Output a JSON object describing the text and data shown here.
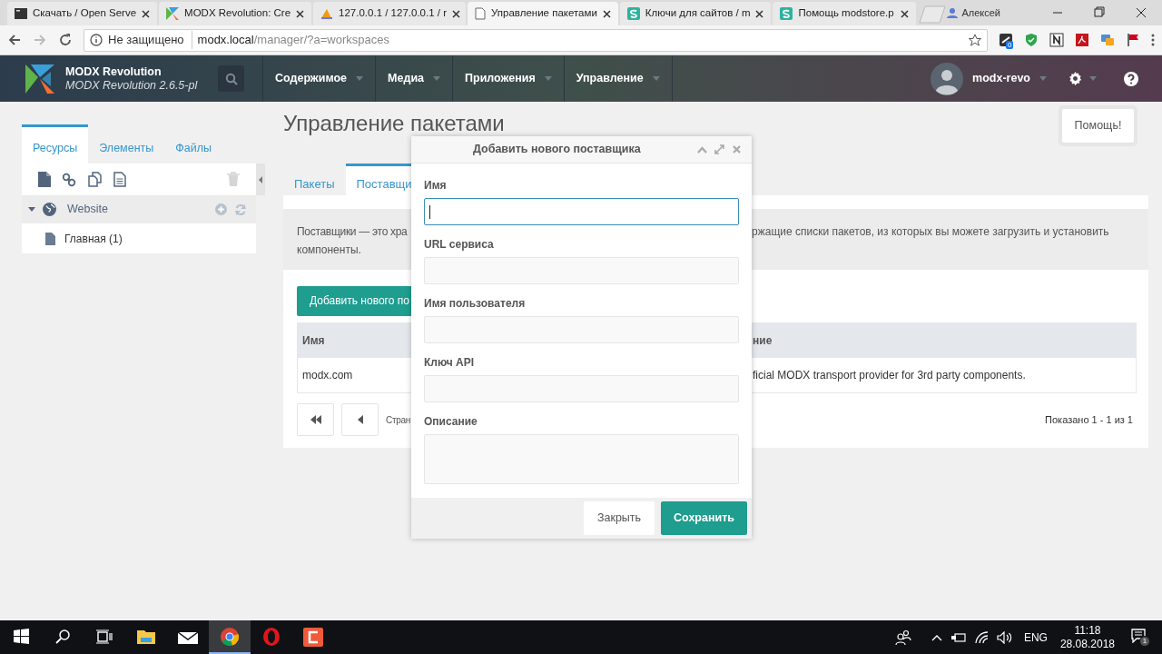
{
  "browser": {
    "tabs": [
      {
        "title": "Скачать / Open Serve",
        "kind": "terminal",
        "selected": false
      },
      {
        "title": "MODX Revolution: Cre",
        "kind": "modx",
        "selected": false
      },
      {
        "title": "127.0.0.1 / 127.0.0.1 / r",
        "kind": "pma",
        "selected": false
      },
      {
        "title": "Управление пакетами",
        "kind": "page",
        "selected": true
      },
      {
        "title": "Ключи для сайтов / m",
        "kind": "store",
        "selected": false
      },
      {
        "title": "Помощь modstore.p",
        "kind": "store",
        "selected": false
      }
    ],
    "profile": "Алексей",
    "address": {
      "security": "Не защищено",
      "host": "modx.local",
      "path": "/manager/?a=workspaces"
    },
    "extension_badge": "0"
  },
  "header": {
    "brand": "MODX Revolution",
    "version": "MODX Revolution 2.6.5-pl",
    "menu": [
      "Содержимое",
      "Медиа",
      "Приложения",
      "Управление"
    ],
    "user": "modx-revo"
  },
  "help_button": "Помощь!",
  "sidebar": {
    "tabs": [
      {
        "label": "Ресурсы",
        "selected": true
      },
      {
        "label": "Элементы",
        "selected": false
      },
      {
        "label": "Файлы",
        "selected": false
      }
    ],
    "tree": [
      {
        "label": "Website",
        "kind": "context",
        "expanded": true,
        "children": [
          {
            "label": "Главная (1)",
            "kind": "page"
          }
        ]
      }
    ]
  },
  "page": {
    "title": "Управление пакетами",
    "tabs": [
      {
        "label": "Пакеты",
        "selected": false
      },
      {
        "label": "Поставщи",
        "selected": true
      }
    ],
    "description": {
      "left": "Поставщики — это хра",
      "right": "ржащие списки пакетов, из которых вы можете загрузить и установить",
      "line_2": "компоненты."
    },
    "add_button": "Добавить нового по",
    "table": {
      "columns": [
        "Имя",
        "ние"
      ],
      "rows": [
        [
          "modx.com",
          "ficial MODX transport provider for 3rd party components."
        ]
      ]
    },
    "pager": {
      "page_label": "Стран",
      "summary": "Показано 1 - 1 из 1"
    }
  },
  "dialog": {
    "title": "Добавить нового поставщика",
    "fields": [
      {
        "label": "Имя",
        "kind": "text",
        "focused": true
      },
      {
        "label": "URL сервиса",
        "kind": "text",
        "focused": false
      },
      {
        "label": "Имя пользователя",
        "kind": "text",
        "focused": false
      },
      {
        "label": "Ключ API",
        "kind": "text",
        "focused": false
      },
      {
        "label": "Описание",
        "kind": "textarea",
        "focused": false
      }
    ],
    "buttons": [
      {
        "label": "Закрыть",
        "kind": "secondary"
      },
      {
        "label": "Сохранить",
        "kind": "primary"
      }
    ]
  },
  "taskbar": {
    "apps": [
      {
        "kind": "folder",
        "active": false
      },
      {
        "kind": "mail",
        "active": false
      },
      {
        "kind": "chrome",
        "active": true
      },
      {
        "kind": "opera",
        "active": false
      },
      {
        "kind": "camtasia",
        "active": false
      }
    ],
    "language": "ENG",
    "time": "11:18",
    "date": "28.08.2018",
    "notifications": "1"
  }
}
